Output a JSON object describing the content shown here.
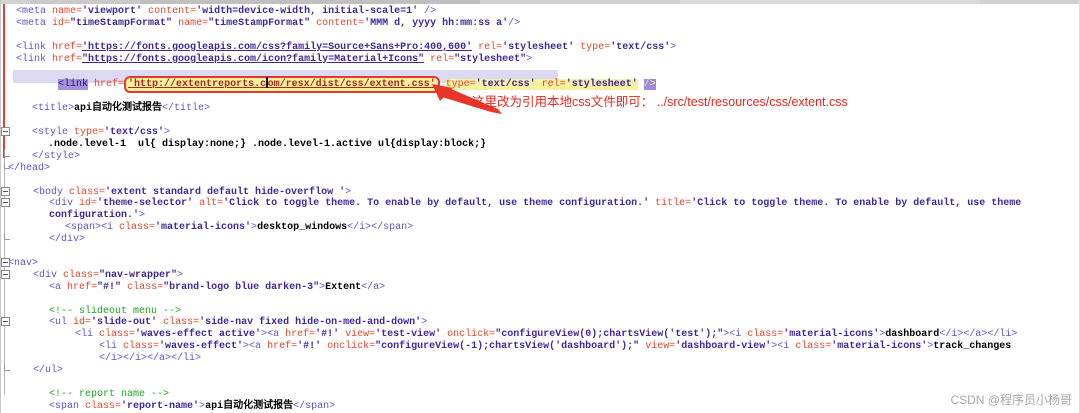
{
  "annotation": {
    "note_text": "这里改为引用本地css文件即可： ../src/test/resources/css/extent.css",
    "accent_color": "#e8281e"
  },
  "watermark": {
    "text": "CSDN @程序员小杨哥"
  },
  "editor": {
    "highlight_line_index": 6,
    "selection_color": "#dcd9f2",
    "mark_color": "#f5f1a0",
    "fold_lines": [
      10,
      15,
      16,
      21,
      22,
      26
    ],
    "tick_lines": [
      12,
      13,
      19,
      30
    ],
    "lines": [
      {
        "indent": 16,
        "segs": [
          [
            "t",
            "<meta "
          ],
          [
            "a",
            "name="
          ],
          [
            "v",
            "'viewport'"
          ],
          [
            "p",
            " "
          ],
          [
            "a",
            "content="
          ],
          [
            "v",
            "'width=device-width, initial-scale=1'"
          ],
          [
            "t",
            " />"
          ]
        ]
      },
      {
        "indent": 16,
        "segs": [
          [
            "t",
            "<meta "
          ],
          [
            "a",
            "id="
          ],
          [
            "v",
            "\"timeStampFormat\""
          ],
          [
            "p",
            " "
          ],
          [
            "a",
            "name="
          ],
          [
            "v",
            "\"timeStampFormat\""
          ],
          [
            "p",
            " "
          ],
          [
            "a",
            "content="
          ],
          [
            "v",
            "'MMM d, yyyy hh:mm:ss a'"
          ],
          [
            "t",
            "/>"
          ]
        ]
      },
      {
        "indent": 0,
        "segs": []
      },
      {
        "indent": 16,
        "segs": [
          [
            "t",
            "<link "
          ],
          [
            "a",
            "href="
          ],
          [
            "u",
            "'https://fonts.googleapis.com/css?family=Source+Sans+Pro:400,600'"
          ],
          [
            "p",
            " "
          ],
          [
            "a",
            "rel="
          ],
          [
            "v",
            "'stylesheet'"
          ],
          [
            "p",
            " "
          ],
          [
            "a",
            "type="
          ],
          [
            "v",
            "'text/css'"
          ],
          [
            "t",
            ">"
          ]
        ]
      },
      {
        "indent": 16,
        "segs": [
          [
            "t",
            "<link "
          ],
          [
            "a",
            "href="
          ],
          [
            "u",
            "\"https://fonts.googleapis.com/icon?family=Material+Icons\""
          ],
          [
            "p",
            " "
          ],
          [
            "a",
            "rel="
          ],
          [
            "v",
            "\"stylesheet\""
          ],
          [
            "t",
            ">"
          ]
        ]
      },
      {
        "indent": 0,
        "segs": []
      },
      {
        "indent": 58,
        "segs": [
          [
            "hlt",
            "<link"
          ],
          [
            "p",
            " "
          ],
          [
            "a",
            "href="
          ],
          [
            "box",
            [
              [
                "yu",
                "'http://extentreports.c"
              ],
              [
                "caret",
                ""
              ],
              [
                "yu",
                "om/resx/dist/css/extent.css'"
              ]
            ]
          ],
          [
            "p",
            " "
          ],
          [
            "ya",
            "type="
          ],
          [
            "yv",
            "'text/css'"
          ],
          [
            "ys",
            " "
          ],
          [
            "ya",
            "rel="
          ],
          [
            "yv",
            "'stylesheet'"
          ],
          [
            "p",
            " "
          ],
          [
            "hle",
            "/>"
          ]
        ]
      },
      {
        "indent": 0,
        "segs": []
      },
      {
        "indent": 32,
        "segs": [
          [
            "t",
            "<title>"
          ],
          [
            "b",
            "api自动化测试报告"
          ],
          [
            "t",
            "</title>"
          ]
        ]
      },
      {
        "indent": 0,
        "segs": []
      },
      {
        "indent": 32,
        "segs": [
          [
            "t",
            "<style "
          ],
          [
            "a",
            "type="
          ],
          [
            "v",
            "'text/css'"
          ],
          [
            "t",
            ">"
          ]
        ]
      },
      {
        "indent": 48,
        "segs": [
          [
            "b",
            ".node.level-1  ul{ display:none;} .node.level-1.active ul{display:block;}"
          ]
        ]
      },
      {
        "indent": 32,
        "segs": [
          [
            "t",
            "</style>"
          ]
        ]
      },
      {
        "indent": 8,
        "segs": [
          [
            "t",
            "</head>"
          ]
        ]
      },
      {
        "indent": 0,
        "segs": []
      },
      {
        "indent": 33,
        "segs": [
          [
            "t",
            "<body "
          ],
          [
            "a",
            "class="
          ],
          [
            "v",
            "'extent standard default hide-overflow '"
          ],
          [
            "t",
            ">"
          ]
        ]
      },
      {
        "indent": 49,
        "segs": [
          [
            "t",
            "<div "
          ],
          [
            "a",
            "id="
          ],
          [
            "v",
            "'theme-selector'"
          ],
          [
            "p",
            " "
          ],
          [
            "a",
            "alt="
          ],
          [
            "v",
            "'Click to toggle theme. To enable by default, use theme configuration.'"
          ],
          [
            "p",
            " "
          ],
          [
            "a",
            "title="
          ],
          [
            "v",
            "'Click to toggle theme. To enable by default, use theme"
          ]
        ]
      },
      {
        "indent": 49,
        "segs": [
          [
            "v",
            "configuration.'"
          ],
          [
            "t",
            ">"
          ]
        ]
      },
      {
        "indent": 65,
        "segs": [
          [
            "t",
            "<span><i "
          ],
          [
            "a",
            "class="
          ],
          [
            "v",
            "'material-icons'"
          ],
          [
            "t",
            ">"
          ],
          [
            "b",
            "desktop_windows"
          ],
          [
            "t",
            "</i></span>"
          ]
        ]
      },
      {
        "indent": 49,
        "segs": [
          [
            "t",
            "</div>"
          ]
        ]
      },
      {
        "indent": 0,
        "segs": []
      },
      {
        "indent": 8,
        "segs": [
          [
            "t",
            "<nav>"
          ]
        ]
      },
      {
        "indent": 33,
        "segs": [
          [
            "t",
            "<div "
          ],
          [
            "a",
            "class="
          ],
          [
            "v",
            "\"nav-wrapper\""
          ],
          [
            "t",
            ">"
          ]
        ]
      },
      {
        "indent": 49,
        "segs": [
          [
            "t",
            "<a "
          ],
          [
            "a",
            "href="
          ],
          [
            "v",
            "\"#!\""
          ],
          [
            "p",
            " "
          ],
          [
            "a",
            "class="
          ],
          [
            "v",
            "\"brand-logo blue darken-3\""
          ],
          [
            "t",
            ">"
          ],
          [
            "b",
            "Extent"
          ],
          [
            "t",
            "</a>"
          ]
        ]
      },
      {
        "indent": 0,
        "segs": []
      },
      {
        "indent": 49,
        "segs": [
          [
            "c",
            "<!-- slideout menu -->"
          ]
        ]
      },
      {
        "indent": 49,
        "segs": [
          [
            "t",
            "<ul "
          ],
          [
            "a",
            "id="
          ],
          [
            "v",
            "'slide-out'"
          ],
          [
            "p",
            " "
          ],
          [
            "a",
            "class="
          ],
          [
            "v",
            "'side-nav fixed hide-on-med-and-down'"
          ],
          [
            "t",
            ">"
          ]
        ]
      },
      {
        "indent": 75,
        "segs": [
          [
            "t",
            "<li "
          ],
          [
            "a",
            "class="
          ],
          [
            "v",
            "'waves-effect active'"
          ],
          [
            "t",
            "><a "
          ],
          [
            "a",
            "href="
          ],
          [
            "v",
            "'#!'"
          ],
          [
            "p",
            " "
          ],
          [
            "a",
            "view="
          ],
          [
            "v",
            "'test-view'"
          ],
          [
            "p",
            " "
          ],
          [
            "a",
            "onclick="
          ],
          [
            "v",
            "\"configureView(0);chartsView('test');\""
          ],
          [
            "t",
            "><i "
          ],
          [
            "a",
            "class="
          ],
          [
            "v",
            "'material-icons'"
          ],
          [
            "t",
            ">"
          ],
          [
            "b",
            "dashboard"
          ],
          [
            "t",
            "</i></a></li>"
          ]
        ]
      },
      {
        "indent": 99,
        "segs": [
          [
            "t",
            "<li "
          ],
          [
            "a",
            "class="
          ],
          [
            "v",
            "'waves-effect'"
          ],
          [
            "t",
            "><a "
          ],
          [
            "a",
            "href="
          ],
          [
            "v",
            "'#!'"
          ],
          [
            "p",
            " "
          ],
          [
            "a",
            "onclick="
          ],
          [
            "v",
            "\"configureView(-1);chartsView('dashboard');\""
          ],
          [
            "p",
            " "
          ],
          [
            "a",
            "view="
          ],
          [
            "v",
            "'dashboard-view'"
          ],
          [
            "t",
            "><i "
          ],
          [
            "a",
            "class="
          ],
          [
            "v",
            "'material-icons'"
          ],
          [
            "t",
            ">"
          ],
          [
            "b",
            "track_changes"
          ]
        ]
      },
      {
        "indent": 99,
        "segs": [
          [
            "t",
            "</i></i></a></li>"
          ]
        ]
      },
      {
        "indent": 33,
        "segs": [
          [
            "t",
            "</ul>"
          ]
        ]
      },
      {
        "indent": 0,
        "segs": []
      },
      {
        "indent": 49,
        "segs": [
          [
            "c",
            "<!-- report name -->"
          ]
        ]
      },
      {
        "indent": 49,
        "segs": [
          [
            "t",
            "<span "
          ],
          [
            "a",
            "class="
          ],
          [
            "v",
            "'report-name'"
          ],
          [
            "t",
            ">"
          ],
          [
            "b",
            "api自动化测试报告"
          ],
          [
            "t",
            "</span>"
          ]
        ]
      }
    ]
  }
}
